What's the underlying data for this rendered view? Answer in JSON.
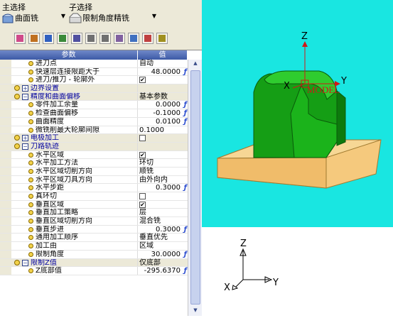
{
  "main_select": {
    "label": "主选择",
    "value": "曲面铣"
  },
  "sub_select": {
    "label": "子选择",
    "value": "限制角度精铣"
  },
  "toolbar": {
    "icons": [
      "eraser-icon",
      "tool-icon",
      "pen-icon",
      "edit-icon",
      "check-icon",
      "copy-icon",
      "paste-icon",
      "export-icon",
      "import-icon",
      "grid-icon",
      "close-icon"
    ]
  },
  "grid": {
    "header": {
      "param": "参数",
      "value": "值"
    },
    "rows": [
      {
        "type": "item",
        "indent": 2,
        "name": "进刀点",
        "value": "自动"
      },
      {
        "type": "item",
        "indent": 2,
        "name": "快速层连接限距大于",
        "value": "48.0000",
        "formula": "ƒ"
      },
      {
        "type": "item",
        "indent": 2,
        "name": "进刀/推刀 - 轮廓外",
        "check": "✔"
      },
      {
        "type": "group",
        "indent": 1,
        "collapsed": true,
        "name": "边界设置"
      },
      {
        "type": "group",
        "indent": 1,
        "collapsed": false,
        "name": "精度和曲面偏移",
        "value": "基本参数"
      },
      {
        "type": "item",
        "indent": 2,
        "name": "零件加工余量",
        "value": "0.0000",
        "formula": "ƒ"
      },
      {
        "type": "item",
        "indent": 2,
        "name": "检查曲面偏移",
        "value": "-0.1000",
        "formula": "ƒ"
      },
      {
        "type": "item",
        "indent": 2,
        "name": "曲面精度",
        "value": "0.0100",
        "formula": "ƒ"
      },
      {
        "type": "item",
        "indent": 2,
        "name": "微铣削最大轮廓间隙",
        "value": "0.1000"
      },
      {
        "type": "group",
        "indent": 1,
        "collapsed": true,
        "name": "电极加工",
        "check": ""
      },
      {
        "type": "group",
        "indent": 1,
        "collapsed": false,
        "name": "刀路轨迹"
      },
      {
        "type": "item",
        "indent": 2,
        "name": "水平区域",
        "check": "✔"
      },
      {
        "type": "item",
        "indent": 2,
        "name": "水平加工方法",
        "value": "环切"
      },
      {
        "type": "item",
        "indent": 2,
        "name": "水平区域切削方向",
        "value": "顺铣"
      },
      {
        "type": "item",
        "indent": 2,
        "name": "水平区域刀具方向",
        "value": "由外向内"
      },
      {
        "type": "item",
        "indent": 2,
        "name": "水平步距",
        "value": "0.3000",
        "formula": "ƒ"
      },
      {
        "type": "item",
        "indent": 2,
        "name": "真环切",
        "check": ""
      },
      {
        "type": "item",
        "indent": 2,
        "name": "垂直区域",
        "check": "✔"
      },
      {
        "type": "item",
        "indent": 2,
        "name": "垂直加工策略",
        "value": "层"
      },
      {
        "type": "item",
        "indent": 2,
        "name": "垂直区域切削方向",
        "value": "混合铣"
      },
      {
        "type": "item",
        "indent": 2,
        "name": "垂直步进",
        "value": "0.3000",
        "formula": "ƒ"
      },
      {
        "type": "item",
        "indent": 2,
        "name": "通用加工顺序",
        "value": "垂直优先"
      },
      {
        "type": "item",
        "indent": 2,
        "name": "加工由",
        "value": "区域"
      },
      {
        "type": "item",
        "indent": 2,
        "name": "限制角度",
        "value": "30.0000",
        "formula": "ƒ"
      },
      {
        "type": "group",
        "indent": 1,
        "collapsed": false,
        "name": "限制Z值",
        "value": "仅底部"
      },
      {
        "type": "item",
        "indent": 2,
        "name": "Z底部值",
        "value": "-295.6370",
        "formula": "ƒ"
      }
    ]
  },
  "view3d": {
    "axis_z": "Z",
    "axis_y": "Y",
    "axis_x": "X",
    "model_label": "MODEL"
  },
  "axes_triad": {
    "axis_z": "Z",
    "axis_y": "Y",
    "axis_x": "X"
  },
  "colors": {
    "background_3d": "#19e6e1",
    "part": "#19a319",
    "stock": "#f5c97d",
    "axis_red": "#d01818"
  }
}
